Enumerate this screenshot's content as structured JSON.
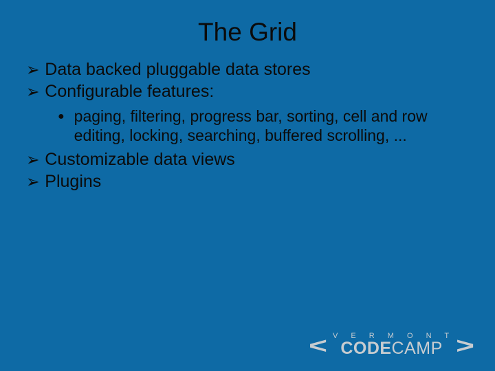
{
  "title": "The Grid",
  "bullets": {
    "b0": "Data backed pluggable data stores",
    "b1": "Configurable features:",
    "b1a": "paging, filtering, progress bar, sorting, cell and row editing, locking, searching, buffered scrolling, ...",
    "b2": "Customizable data views",
    "b3": "Plugins"
  },
  "marks": {
    "arrow": "➢",
    "dot": "●"
  },
  "logo": {
    "lt": "<",
    "gt": ">",
    "top": "V E R M O N T",
    "code": "CODE",
    "camp": "CAMP"
  }
}
